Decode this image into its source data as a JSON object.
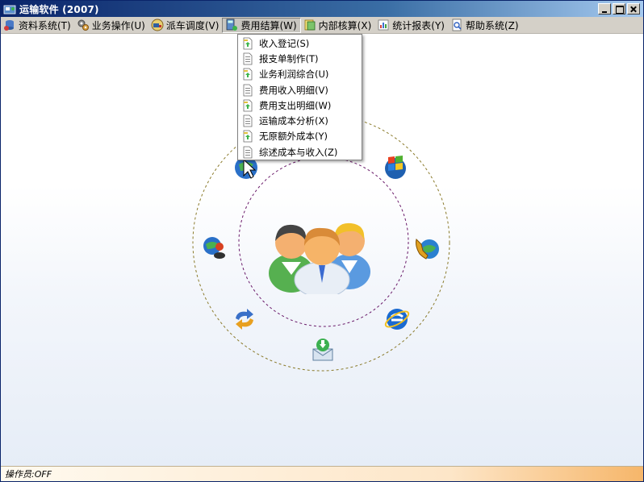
{
  "window": {
    "title": "运输软件 (2007)"
  },
  "menubar": {
    "items": [
      {
        "label": "资料系统(T)",
        "icon": "database-icon"
      },
      {
        "label": "业务操作(U)",
        "icon": "gears-icon"
      },
      {
        "label": "派车调度(V)",
        "icon": "truck-icon"
      },
      {
        "label": "费用结算(W)",
        "icon": "calculator-icon"
      },
      {
        "label": "内部核算(X)",
        "icon": "ledger-icon"
      },
      {
        "label": "统计报表(Y)",
        "icon": "report-icon"
      },
      {
        "label": "帮助系统(Z)",
        "icon": "help-icon"
      }
    ]
  },
  "dropdown": {
    "items": [
      {
        "label": "收入登记(S)",
        "icon": "document-icon"
      },
      {
        "label": "报支单制作(T)",
        "icon": "document-icon"
      },
      {
        "label": "业务利润综合(U)",
        "icon": "document-icon"
      },
      {
        "label": "费用收入明细(V)",
        "icon": "document-icon"
      },
      {
        "label": "费用支出明细(W)",
        "icon": "document-icon"
      },
      {
        "label": "运输成本分析(X)",
        "icon": "document-icon"
      },
      {
        "label": "无原额外成本(Y)",
        "icon": "document-icon"
      },
      {
        "label": "综述成本与收入(Z)",
        "icon": "document-icon"
      }
    ]
  },
  "orbit_icons": [
    {
      "name": "cursor-globe-icon"
    },
    {
      "name": "windows-flag-icon"
    },
    {
      "name": "phone-globe-icon"
    },
    {
      "name": "internet-explorer-icon"
    },
    {
      "name": "download-mail-icon"
    },
    {
      "name": "sync-arrows-icon"
    },
    {
      "name": "user-globe-icon"
    }
  ],
  "center_graphic": "users-group-icon",
  "statusbar": {
    "text": "操作员:OFF"
  },
  "colors": {
    "title_bar": "#0a246a",
    "menu_bg": "#d4d0c8",
    "outer_ring": "#8a7a2a",
    "inner_ring": "#6a1a6a"
  }
}
